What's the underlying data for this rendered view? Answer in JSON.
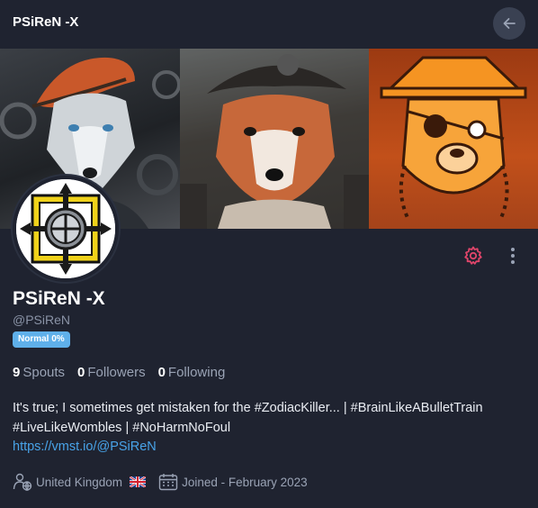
{
  "header": {
    "title": "PSiReN -X",
    "back_icon": "arrow-left-icon"
  },
  "banner": {
    "panels": [
      {
        "description_icon": "wolf-pirate-art"
      },
      {
        "description_icon": "shiba-pirate-art"
      },
      {
        "description_icon": "orange-pirate-dog-art"
      }
    ]
  },
  "avatar": {
    "icon": "celtic-cross-emblem"
  },
  "actions": {
    "settings_icon": "gear-icon",
    "more_icon": "more-vertical-icon",
    "gear_color": "#e0456a"
  },
  "profile": {
    "name": "PSiReN -X",
    "handle": "@PSiReN",
    "badge": "Normal 0%"
  },
  "stats": {
    "spouts_count": "9",
    "spouts_label": "Spouts",
    "followers_count": "0",
    "followers_label": "Followers",
    "following_count": "0",
    "following_label": "Following"
  },
  "bio": {
    "line1": "It's true; I sometimes get mistaken for the #ZodiacKiller... | #BrainLikeABulletTrain",
    "line2": "#LiveLikeWombles | #NoHarmNoFoul",
    "link": "https://vmst.io/@PSiReN"
  },
  "meta": {
    "location": "United Kingdom",
    "joined": "Joined - February 2023",
    "location_icon": "person-globe-icon",
    "calendar_icon": "calendar-icon",
    "flag_icon": "uk-flag-icon"
  },
  "colors": {
    "background": "#1f2330",
    "accent_link": "#48a3e8",
    "badge": "#5fb0ea"
  }
}
